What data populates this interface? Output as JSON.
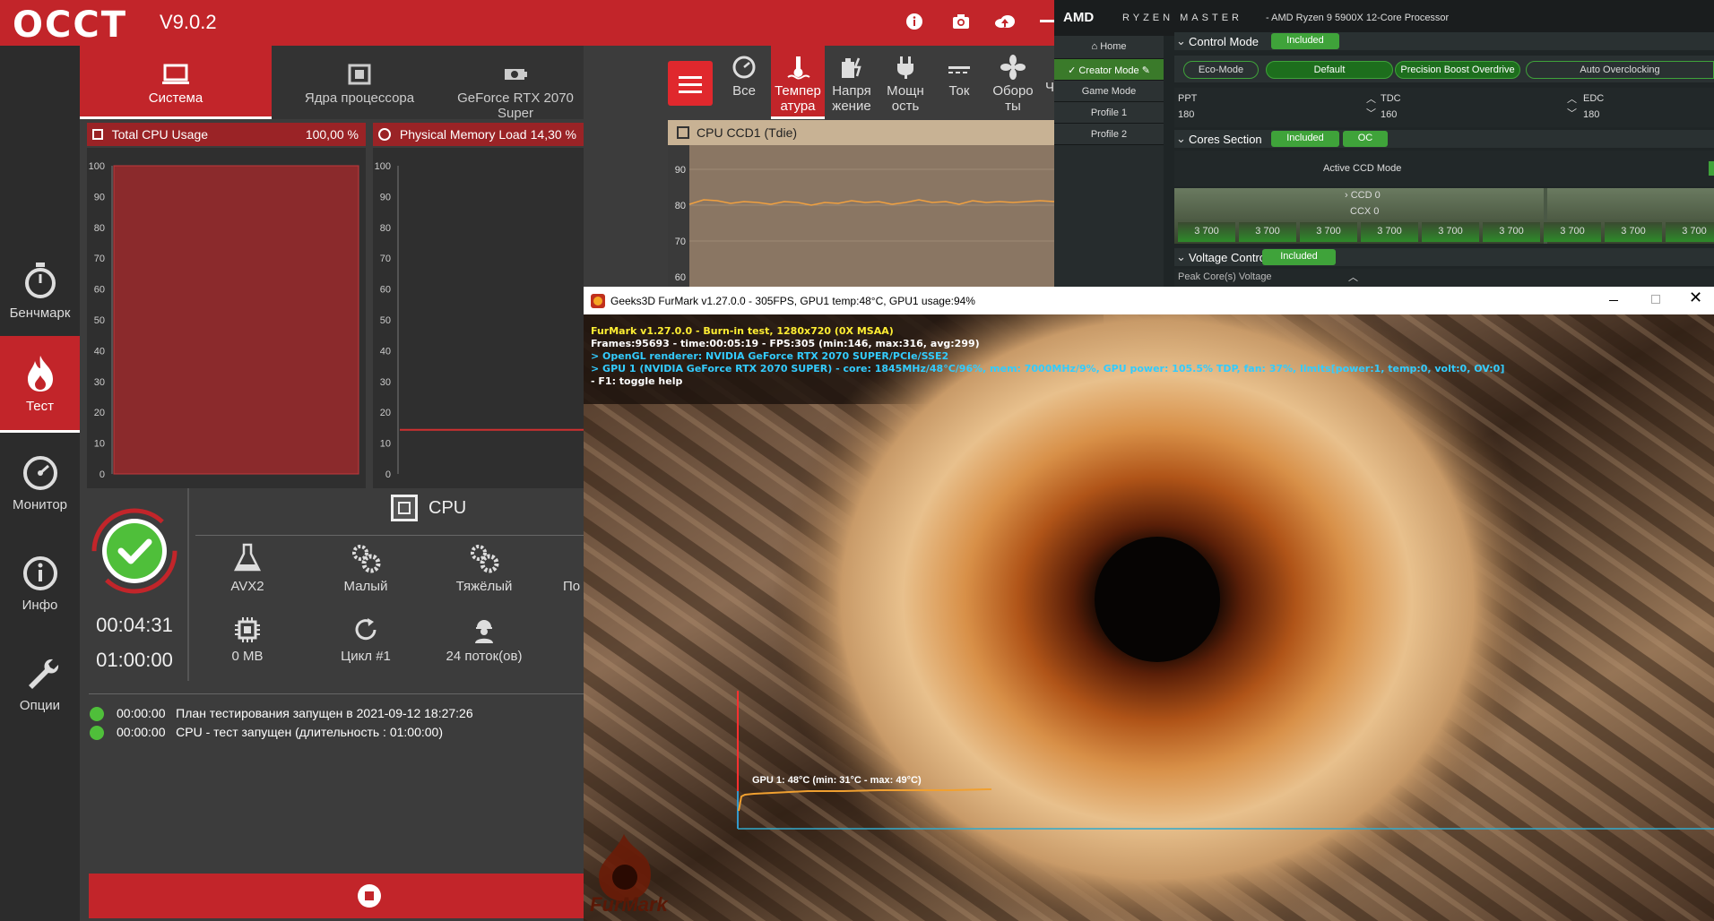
{
  "occt": {
    "logo": "OCCT",
    "version": "V9.0.2",
    "sidebar": [
      {
        "label": "Бенчмарк",
        "icon": "stopwatch-icon"
      },
      {
        "label": "Тест",
        "icon": "flame-icon"
      },
      {
        "label": "Монитор",
        "icon": "gauge-icon"
      },
      {
        "label": "Инфо",
        "icon": "info-icon"
      },
      {
        "label": "Опции",
        "icon": "wrench-icon"
      }
    ],
    "tabs": [
      {
        "label": "Система",
        "icon": "monitor-icon"
      },
      {
        "label": "Ядра процессора",
        "icon": "cpu-icon"
      },
      {
        "label": "GeForce RTX 2070 Super",
        "icon": "gpu-icon"
      }
    ],
    "graph1": {
      "title": "Total CPU Usage",
      "value": "100,00 %",
      "level": 1.0
    },
    "graph2": {
      "title": "Physical Memory Load",
      "value": "14,30 %",
      "level": 0.143
    },
    "y_ticks": [
      "100",
      "90",
      "80",
      "70",
      "60",
      "50",
      "40",
      "30",
      "20",
      "10",
      "0"
    ],
    "timer_elapsed": "00:04:31",
    "timer_total": "01:00:00",
    "test_title": "CPU",
    "features": [
      {
        "label": "AVX2",
        "icon": "flask-icon"
      },
      {
        "label": "Малый",
        "icon": "gears-icon"
      },
      {
        "label": "Тяжёлый",
        "icon": "gears-icon"
      },
      {
        "label": "По",
        "icon": ""
      },
      {
        "label": "0 MB",
        "icon": "chip-icon"
      },
      {
        "label": "Цикл #1",
        "icon": "refresh-icon"
      },
      {
        "label": "24 поток(ов)",
        "icon": "worker-icon"
      }
    ],
    "log": [
      {
        "time": "00:00:00",
        "text": "План тестирования запущен в 2021-09-12 18:27:26"
      },
      {
        "time": "00:00:00",
        "text": "CPU - тест запущен (длительность : 01:00:00)"
      }
    ],
    "sensor_tabs": [
      {
        "label1": "Все",
        "label2": ""
      },
      {
        "label1": "Темпер",
        "label2": "атура"
      },
      {
        "label1": "Напря",
        "label2": "жение"
      },
      {
        "label1": "Мощн",
        "label2": "ость"
      },
      {
        "label1": "Ток",
        "label2": ""
      },
      {
        "label1": "Оборо",
        "label2": "ты"
      },
      {
        "label1": "Ч",
        "label2": ""
      }
    ],
    "sensor_graph": {
      "title": "CPU CCD1 (Tdie)",
      "ticks": [
        "90",
        "80",
        "70",
        "60"
      ]
    }
  },
  "ryzen": {
    "brand": "AMD",
    "product": "RYZEN MASTER",
    "cpu": "AMD Ryzen 9 5900X 12-Core Processor",
    "nav": [
      "Home",
      "Creator Mode",
      "Game Mode",
      "Profile 1",
      "Profile 2"
    ],
    "control_mode": "Control Mode",
    "included": "Included",
    "modes": [
      "Eco-Mode",
      "Default",
      "Precision Boost Overdrive",
      "Auto Overclocking"
    ],
    "limits": [
      {
        "name": "PPT",
        "value": "180"
      },
      {
        "name": "TDC",
        "value": "160"
      },
      {
        "name": "EDC",
        "value": "180"
      }
    ],
    "cores_section": "Cores Section",
    "oc": "OC",
    "active_ccd": "Active CCD Mode",
    "ccd": "CCD 0",
    "ccx": "CCX 0",
    "core_freq": [
      "3 700",
      "3 700",
      "3 700",
      "3 700",
      "3 700",
      "3 700",
      "3 700",
      "3 700",
      "3 700"
    ],
    "voltage_control": "Voltage Control",
    "peak_voltage": "Peak Core(s) Voltage"
  },
  "furmark": {
    "title": "Geeks3D FurMark v1.27.0.0 - 305FPS, GPU1 temp:48°C, GPU1 usage:94%",
    "lines": [
      "FurMark v1.27.0.0 - Burn-in test, 1280x720 (0X MSAA)",
      "Frames:95693 - time:00:05:19 - FPS:305 (min:146, max:316, avg:299)",
      "> OpenGL renderer: NVIDIA GeForce RTX 2070 SUPER/PCIe/SSE2",
      "> GPU 1 (NVIDIA GeForce RTX 2070 SUPER) - core: 1845MHz/48°C/96%, mem: 7000MHz/9%, GPU power: 105.5% TDP, fan: 37%, limits[power:1, temp:0, volt:0, OV:0]",
      "- F1: toggle help"
    ],
    "temp_label": "GPU 1: 48°C (min: 31°C - max: 49°C)",
    "logo": "FurMark",
    "colors": {
      "yellow": "#ffee33",
      "white": "#ffffff",
      "cyan": "#33ccff"
    }
  }
}
